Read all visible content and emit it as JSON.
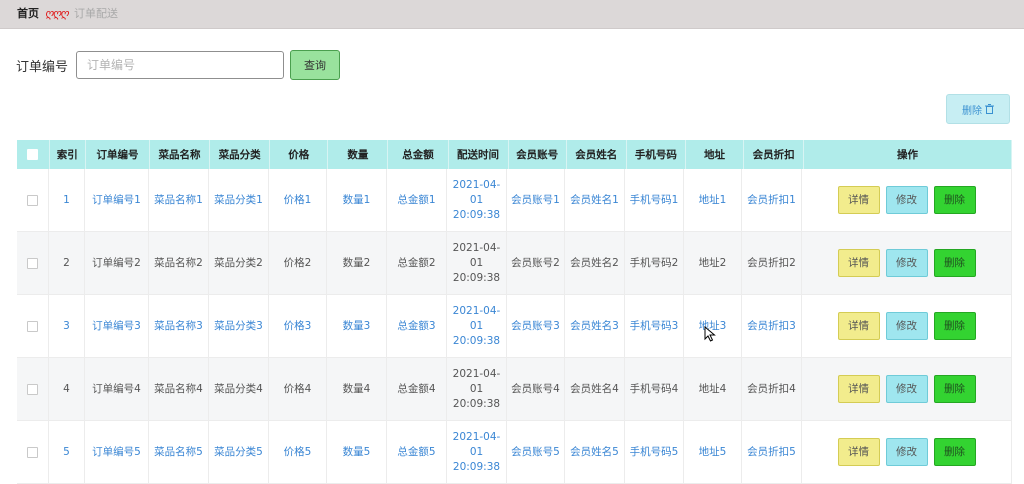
{
  "breadcrumb": {
    "home": "首页",
    "separator": "ღღღ",
    "current": "订单配送"
  },
  "search": {
    "label": "订单编号",
    "placeholder": "订单编号",
    "value": "",
    "button": "查询"
  },
  "toolbar": {
    "batch_delete": "删除",
    "batch_delete_icon": "trash-icon"
  },
  "table": {
    "headers": [
      "索引",
      "订单编号",
      "菜品名称",
      "菜品分类",
      "价格",
      "数量",
      "总金额",
      "配送时间",
      "会员账号",
      "会员姓名",
      "手机号码",
      "地址",
      "会员折扣",
      "操作"
    ],
    "actions": {
      "detail": "详情",
      "edit": "修改",
      "delete": "删除"
    },
    "colors": {
      "header_bg": "#b0ecea",
      "link": "#3a86d4",
      "detail_btn": "#f2ec8d",
      "edit_btn": "#9fe6ef",
      "delete_btn": "#33d331"
    },
    "rows": [
      {
        "index": "1",
        "order_no": "订单编号1",
        "dish": "菜品名称1",
        "category": "菜品分类1",
        "price": "价格1",
        "qty": "数量1",
        "total": "总金额1",
        "time": "2021-04-01 20:09:38",
        "account": "会员账号1",
        "name": "会员姓名1",
        "phone": "手机号码1",
        "address": "地址1",
        "discount": "会员折扣1"
      },
      {
        "index": "2",
        "order_no": "订单编号2",
        "dish": "菜品名称2",
        "category": "菜品分类2",
        "price": "价格2",
        "qty": "数量2",
        "total": "总金额2",
        "time": "2021-04-01 20:09:38",
        "account": "会员账号2",
        "name": "会员姓名2",
        "phone": "手机号码2",
        "address": "地址2",
        "discount": "会员折扣2"
      },
      {
        "index": "3",
        "order_no": "订单编号3",
        "dish": "菜品名称3",
        "category": "菜品分类3",
        "price": "价格3",
        "qty": "数量3",
        "total": "总金额3",
        "time": "2021-04-01 20:09:38",
        "account": "会员账号3",
        "name": "会员姓名3",
        "phone": "手机号码3",
        "address": "地址3",
        "discount": "会员折扣3"
      },
      {
        "index": "4",
        "order_no": "订单编号4",
        "dish": "菜品名称4",
        "category": "菜品分类4",
        "price": "价格4",
        "qty": "数量4",
        "total": "总金额4",
        "time": "2021-04-01 20:09:38",
        "account": "会员账号4",
        "name": "会员姓名4",
        "phone": "手机号码4",
        "address": "地址4",
        "discount": "会员折扣4"
      },
      {
        "index": "5",
        "order_no": "订单编号5",
        "dish": "菜品名称5",
        "category": "菜品分类5",
        "price": "价格5",
        "qty": "数量5",
        "total": "总金额5",
        "time": "2021-04-01 20:09:38",
        "account": "会员账号5",
        "name": "会员姓名5",
        "phone": "手机号码5",
        "address": "地址5",
        "discount": "会员折扣5"
      }
    ]
  }
}
